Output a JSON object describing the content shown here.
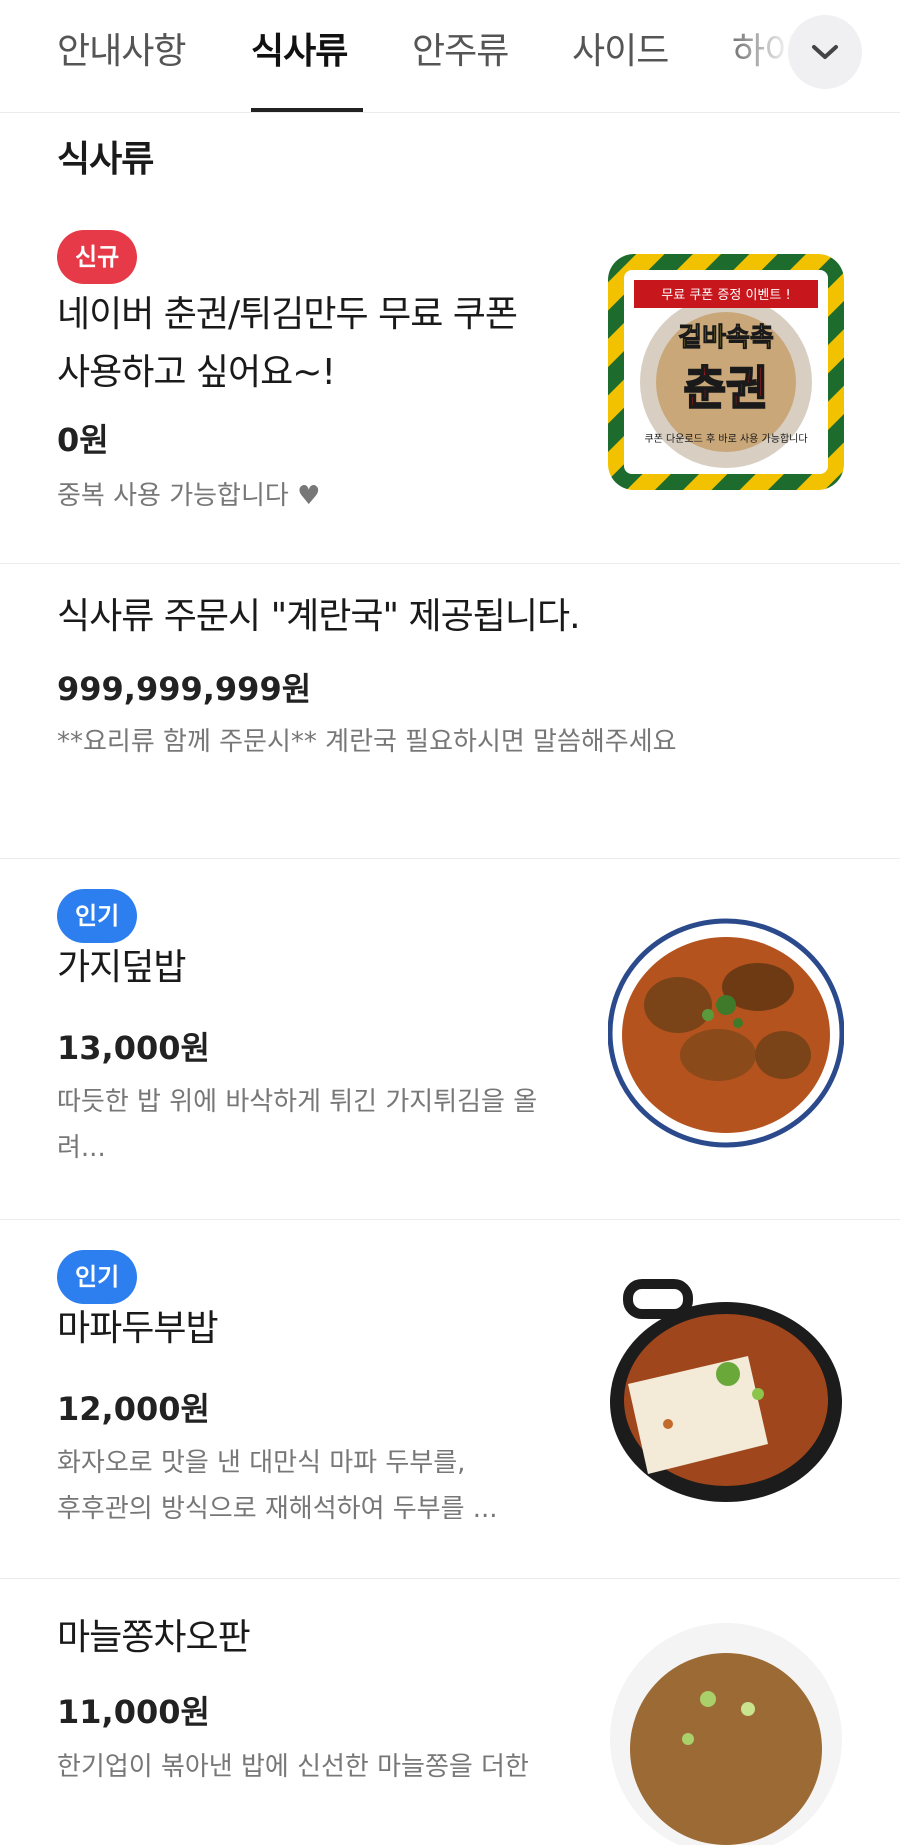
{
  "tabs": [
    {
      "label": "안내사항"
    },
    {
      "label": "식사류"
    },
    {
      "label": "안주류"
    },
    {
      "label": "사이드"
    },
    {
      "label": "하이"
    }
  ],
  "section_title": "식사류",
  "items": [
    {
      "badge": "신규",
      "name": "네이버 춘권/튀김만두 무료 쿠폰 사용하고 싶어요~!",
      "price": "0원",
      "desc": "중복 사용 가능합니다 ♥",
      "image": {
        "banner": "무료 쿠폰 증정 이벤트 !",
        "line1": "겉바속촉",
        "line2": "춘권",
        "footer": "쿠폰 다운로드 후 바로 사용 가능합니다"
      }
    },
    {
      "name": "식사류 주문시 \"계란국\" 제공됩니다.",
      "price": "999,999,999원",
      "desc": "**요리류 함께 주문시** 계란국 필요하시면 말씀해주세요"
    },
    {
      "badge": "인기",
      "name": "가지덮밥",
      "price": "13,000원",
      "desc": "따듯한 밥 위에 바삭하게 튀긴 가지튀김을 올려..."
    },
    {
      "badge": "인기",
      "name": "마파두부밥",
      "price": "12,000원",
      "desc_line1": "화자오로 맛을 낸 대만식 마파 두부를,",
      "desc_line2": "후후관의 방식으로 재해석하여 두부를 ..."
    },
    {
      "name": "마늘쫑차오판",
      "price": "11,000원",
      "desc": "한기업이 볶아낸 밥에 신선한 마늘쫑을 더한"
    }
  ],
  "colors": {
    "new_badge": "#e63a48",
    "popular_badge": "#2d7ff0"
  },
  "icons": {
    "expand": "chevron-down-icon"
  }
}
